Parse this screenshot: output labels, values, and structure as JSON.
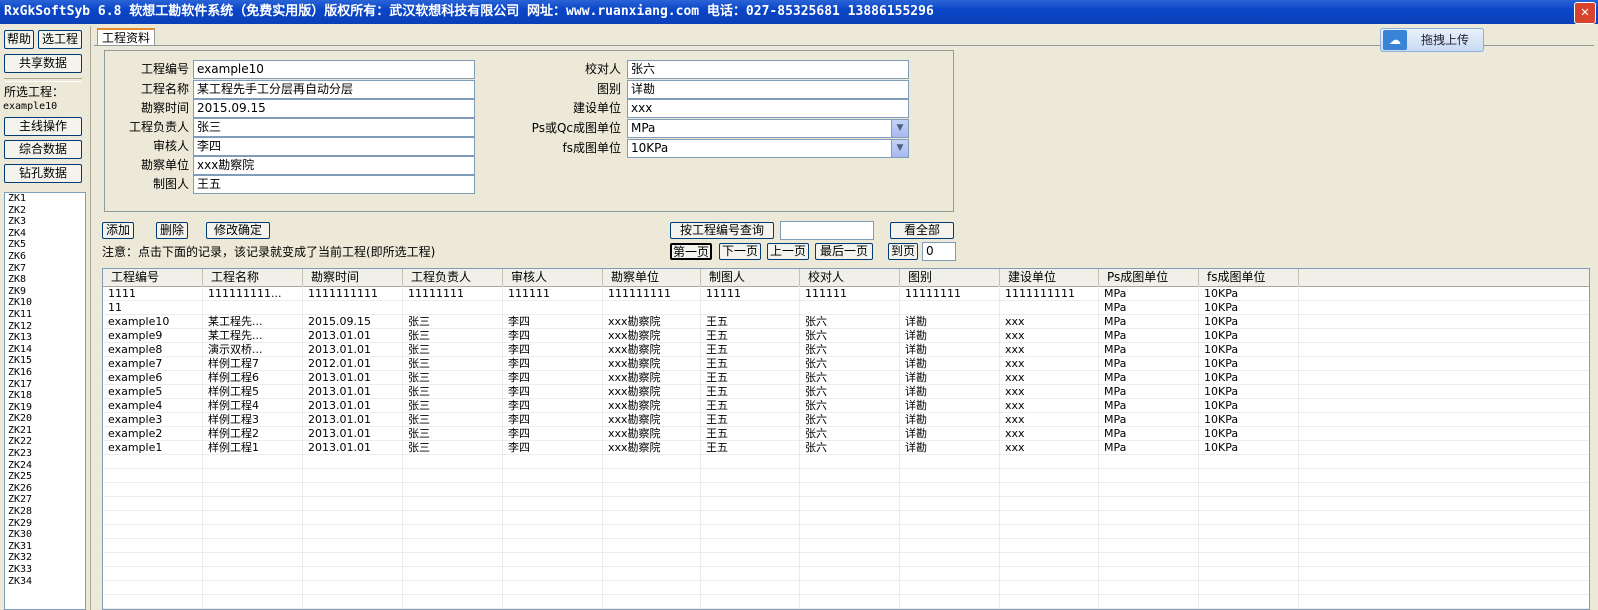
{
  "title": "RxGkSoftSyb 6.8 软想工勘软件系统（免费实用版）版权所有：武汉软想科技有限公司 网址：www.ruanxiang.com 电话：027-85325681 13886155296",
  "sidebar": {
    "help": "帮助",
    "select_project": "选工程",
    "shared_data": "共享数据",
    "selected_label": "所选工程：",
    "selected_value": "example10",
    "main_operation": "主线操作",
    "combined_data": "综合数据",
    "drill_data": "钻孔数据",
    "boreholes": [
      "ZK1",
      "ZK2",
      "ZK3",
      "ZK4",
      "ZK5",
      "ZK6",
      "ZK7",
      "ZK8",
      "ZK9",
      "ZK10",
      "ZK11",
      "ZK12",
      "ZK13",
      "ZK14",
      "ZK15",
      "ZK16",
      "ZK17",
      "ZK18",
      "ZK19",
      "ZK20",
      "ZK21",
      "ZK22",
      "ZK23",
      "ZK24",
      "ZK25",
      "ZK26",
      "ZK27",
      "ZK28",
      "ZK29",
      "ZK30",
      "ZK31",
      "ZK32",
      "ZK33",
      "ZK34"
    ]
  },
  "tab_label": "工程资料",
  "upload_label": "拖拽上传",
  "form": {
    "left": [
      {
        "label": "工程编号",
        "value": "example10"
      },
      {
        "label": "工程名称",
        "value": "某工程先手工分层再自动分层"
      },
      {
        "label": "勘察时间",
        "value": "2015.09.15"
      },
      {
        "label": "工程负责人",
        "value": "张三"
      },
      {
        "label": "审核人",
        "value": "李四"
      },
      {
        "label": "勘察单位",
        "value": "xxx勘察院"
      },
      {
        "label": "制图人",
        "value": "王五"
      }
    ],
    "right": [
      {
        "label": "校对人",
        "value": "张六"
      },
      {
        "label": "图别",
        "value": "详勘"
      },
      {
        "label": "建设单位",
        "value": "xxx"
      },
      {
        "label": "Ps或Qc成图单位",
        "value": "MPa"
      },
      {
        "label": "fs成图单位",
        "value": "10KPa"
      }
    ]
  },
  "actions": {
    "add": "添加",
    "delete": "删除",
    "confirm": "修改确定",
    "query_by_id": "按工程编号查询",
    "query_value": "",
    "show_all": "看全部",
    "first_page": "第一页",
    "next_page": "下一页",
    "prev_page": "上一页",
    "last_page": "最后一页",
    "goto_page": "到页",
    "page_value": "0"
  },
  "note": "注意：点击下面的记录，该记录就变成了当前工程(即所选工程)",
  "table": {
    "columns": [
      "工程编号",
      "工程名称",
      "勘察时间",
      "工程负责人",
      "审核人",
      "勘察单位",
      "制图人",
      "校对人",
      "图别",
      "建设单位",
      "Ps成图单位",
      "fs成图单位"
    ],
    "rows": [
      [
        "1111",
        "111111111...",
        "1111111111",
        "11111111",
        "111111",
        "111111111",
        "11111",
        "111111",
        "11111111",
        "1111111111",
        "MPa",
        "10KPa"
      ],
      [
        "11",
        "",
        "",
        "",
        "",
        "",
        "",
        "",
        "",
        "",
        "MPa",
        "10KPa"
      ],
      [
        "example10",
        "某工程先...",
        "2015.09.15",
        "张三",
        "李四",
        "xxx勘察院",
        "王五",
        "张六",
        "详勘",
        "xxx",
        "MPa",
        "10KPa"
      ],
      [
        "example9",
        "某工程先...",
        "2013.01.01",
        "张三",
        "李四",
        "xxx勘察院",
        "王五",
        "张六",
        "详勘",
        "xxx",
        "MPa",
        "10KPa"
      ],
      [
        "example8",
        "演示双桥...",
        "2013.01.01",
        "张三",
        "李四",
        "xxx勘察院",
        "王五",
        "张六",
        "详勘",
        "xxx",
        "MPa",
        "10KPa"
      ],
      [
        "example7",
        "样例工程7",
        "2012.01.01",
        "张三",
        "李四",
        "xxx勘察院",
        "王五",
        "张六",
        "详勘",
        "xxx",
        "MPa",
        "10KPa"
      ],
      [
        "example6",
        "样例工程6",
        "2013.01.01",
        "张三",
        "李四",
        "xxx勘察院",
        "王五",
        "张六",
        "详勘",
        "xxx",
        "MPa",
        "10KPa"
      ],
      [
        "example5",
        "样例工程5",
        "2013.01.01",
        "张三",
        "李四",
        "xxx勘察院",
        "王五",
        "张六",
        "详勘",
        "xxx",
        "MPa",
        "10KPa"
      ],
      [
        "example4",
        "样例工程4",
        "2013.01.01",
        "张三",
        "李四",
        "xxx勘察院",
        "王五",
        "张六",
        "详勘",
        "xxx",
        "MPa",
        "10KPa"
      ],
      [
        "example3",
        "样例工程3",
        "2013.01.01",
        "张三",
        "李四",
        "xxx勘察院",
        "王五",
        "张六",
        "详勘",
        "xxx",
        "MPa",
        "10KPa"
      ],
      [
        "example2",
        "样例工程2",
        "2013.01.01",
        "张三",
        "李四",
        "xxx勘察院",
        "王五",
        "张六",
        "详勘",
        "xxx",
        "MPa",
        "10KPa"
      ],
      [
        "example1",
        "样例工程1",
        "2013.01.01",
        "张三",
        "李四",
        "xxx勘察院",
        "王五",
        "张六",
        "详勘",
        "xxx",
        "MPa",
        "10KPa"
      ]
    ]
  }
}
